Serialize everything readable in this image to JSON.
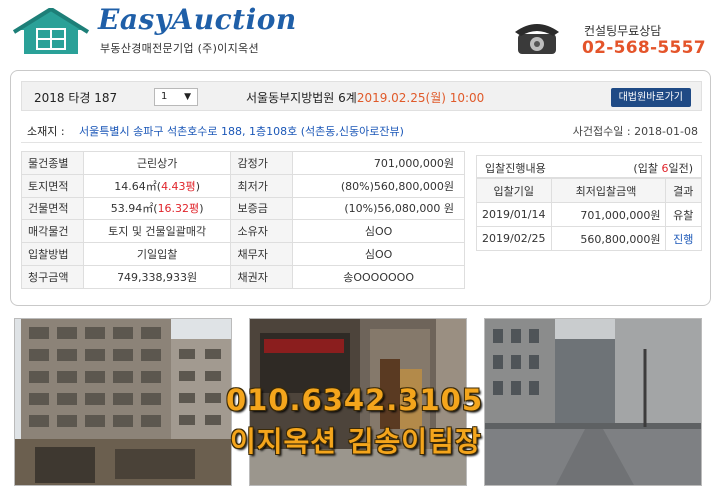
{
  "header": {
    "logo_title": "EasyAuction",
    "logo_subtitle": "부동산경매전문기업 (주)이지옥션",
    "consult_label": "컨설팅무료상담",
    "consult_phone": "02-568-5557",
    "logo_icon": "house-logo-icon",
    "phone_icon": "telephone-icon"
  },
  "case": {
    "case_number": "2018 타경 187",
    "select_value": "1",
    "court": "서울동부지방법원 6계",
    "court_date": "2019.02.25(월) 10:00",
    "court_button": "대법원바로가기"
  },
  "address": {
    "label": "소재지 :",
    "value": "서울특별시 송파구 석촌호수로 188, 1층108호 (석촌동,신동아로잔뷰)",
    "receipt": "사건접수일 : 2018-01-08"
  },
  "info": {
    "rows": [
      {
        "l1": "물건종별",
        "v1": "근린상가",
        "l2": "감정가",
        "v2": "701,000,000원"
      },
      {
        "l1": "토지면적",
        "v1a": "14.64㎡(",
        "v1b": "4.43평",
        "v1c": ")",
        "l2": "최저가",
        "v2": "(80%)560,800,000원"
      },
      {
        "l1": "건물면적",
        "v1a": "53.94㎡(",
        "v1b": "16.32평",
        "v1c": ")",
        "l2": "보증금",
        "v2": "(10%)56,080,000 원"
      },
      {
        "l1": "매각물건",
        "v1": "토지 및 건물일괄매각",
        "l2": "소유자",
        "v2": "심OO"
      },
      {
        "l1": "입찰방법",
        "v1": "기일입찰",
        "l2": "채무자",
        "v2": "심OO"
      },
      {
        "l1": "청구금액",
        "v1": "749,338,933원",
        "l2": "채권자",
        "v2": "송OOOOOOO"
      }
    ]
  },
  "bid": {
    "title": "입찰진행내용",
    "days_prefix": "(입찰 ",
    "days_num": "6",
    "days_suffix": "일전)",
    "headers": [
      "입찰기일",
      "최저입찰금액",
      "결과"
    ],
    "rows": [
      {
        "date": "2019/01/14",
        "amount": "701,000,000원",
        "result": "유찰"
      },
      {
        "date": "2019/02/25",
        "amount": "560,800,000원",
        "result": "진행"
      }
    ]
  },
  "overlay": {
    "phone": "010.6342.3105",
    "name": "이지옥션 김송이팀장"
  },
  "colors": {
    "brand_blue": "#1f5fa8",
    "phone_orange": "#e4542a",
    "price_red": "#e0242b",
    "link_blue": "#1c58b8",
    "button_navy": "#1f4a85",
    "overlay_gold": "#f4a51c"
  }
}
